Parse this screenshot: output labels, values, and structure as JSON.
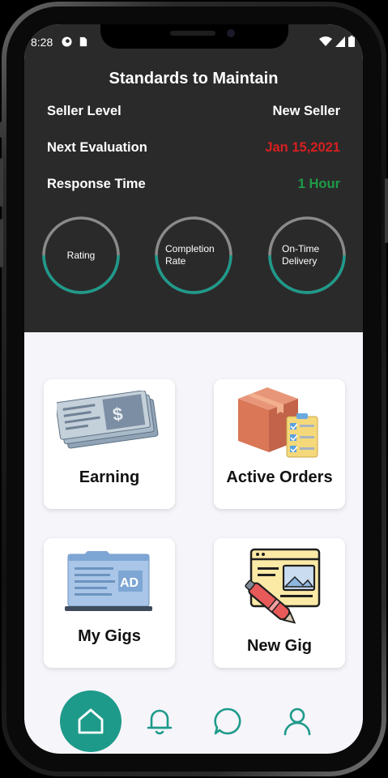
{
  "status_bar": {
    "time": "8:28"
  },
  "header": {
    "title": "Standards to Maintain"
  },
  "rows": [
    {
      "label": "Seller Level",
      "value": "New Seller"
    },
    {
      "label": "Next Evaluation",
      "value": "Jan 15,2021"
    },
    {
      "label": "Response Time",
      "value": "1 Hour"
    }
  ],
  "gauges": [
    {
      "label": "Rating",
      "progress": 0.5
    },
    {
      "label": "Completion Rate",
      "progress": 0.5
    },
    {
      "label": "On-Time Delivery",
      "progress": 0.5
    }
  ],
  "cards": {
    "earning": "Earning",
    "active_orders": "Active Orders",
    "my_gigs": "My Gigs",
    "new_gig": "New Gig"
  },
  "colors": {
    "header_bg": "#2a2a2b",
    "accent": "#1e9a8a",
    "value_red": "#d62020",
    "value_green": "#1e9b47"
  },
  "nav": [
    "home-icon",
    "bell-icon",
    "chat-icon",
    "profile-icon"
  ]
}
